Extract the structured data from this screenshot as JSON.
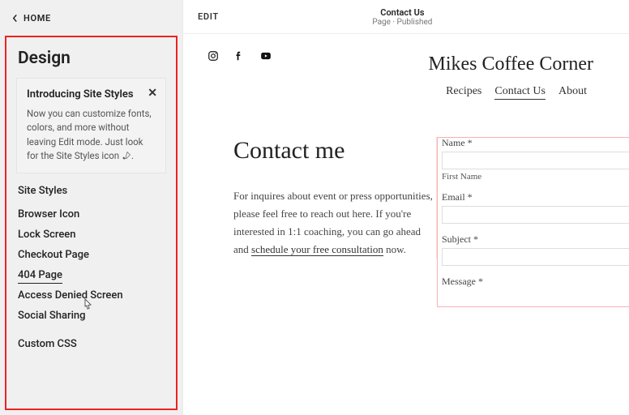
{
  "sidebar": {
    "home_label": "HOME",
    "panel_title": "Design",
    "card": {
      "title": "Introducing Site Styles",
      "body_prefix": "Now you can customize fonts, colors, and more without leaving Edit mode. Just look for the Site Styles icon ",
      "body_suffix": "."
    },
    "site_styles": "Site Styles",
    "items": [
      "Browser Icon",
      "Lock Screen",
      "Checkout Page",
      "404 Page",
      "Access Denied Screen",
      "Social Sharing"
    ],
    "custom_css": "Custom CSS",
    "active_index": 3
  },
  "canvas": {
    "edit": "EDIT",
    "context_title": "Contact Us",
    "context_sub": "Page · Published"
  },
  "page": {
    "brand": "Mikes Coffee Corner",
    "nav": [
      "Recipes",
      "Contact Us",
      "About"
    ],
    "nav_active_index": 1,
    "heading": "Contact me",
    "para_prefix": "For inquires about event or press opportunities, please feel free to reach out here. If you're interested in 1:1 coaching, you can go ahead and ",
    "para_link": "schedule your free consultation",
    "para_suffix": " now.",
    "form": {
      "name_label": "Name *",
      "first_name": "First Name",
      "email_label": "Email *",
      "subject_label": "Subject *",
      "message_label": "Message *"
    }
  }
}
